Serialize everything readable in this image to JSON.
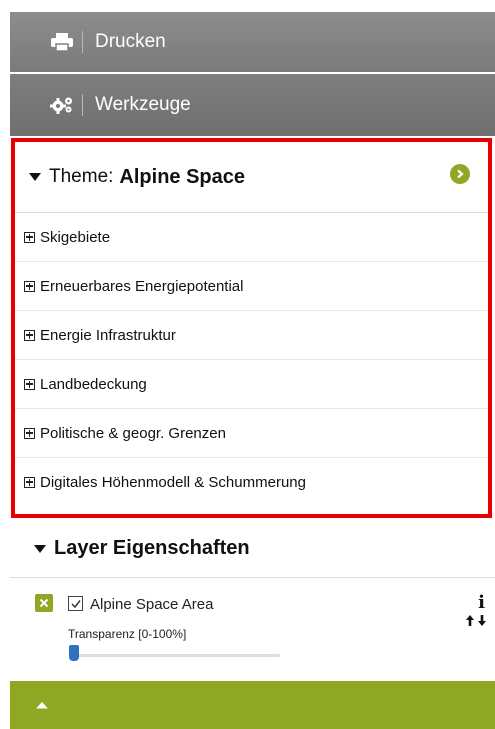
{
  "toolbar": {
    "print_label": "Drucken",
    "tools_label": "Werkzeuge",
    "print_icon": "printer-icon",
    "tools_icon": "gears-icon"
  },
  "theme": {
    "prefix": "Theme:",
    "name": "Alpine Space",
    "items": [
      "Skigebiete",
      "Erneuerbares Energiepotential",
      "Energie Infrastruktur",
      "Landbedeckung",
      "Politische & geogr. Grenzen",
      "Digitales Höhenmodell & Schummerung"
    ]
  },
  "layers": {
    "title": "Layer Eigenschaften",
    "items": [
      {
        "name": "Alpine Space Area",
        "checked": true,
        "transparency_label": "Transparenz [0-100%]",
        "transparency_value": 0
      }
    ]
  },
  "colors": {
    "accent": "#8fa824",
    "highlight_border": "#e60000",
    "toolbar_bg": "#7f7f7f",
    "slider_handle": "#2f72c2"
  }
}
